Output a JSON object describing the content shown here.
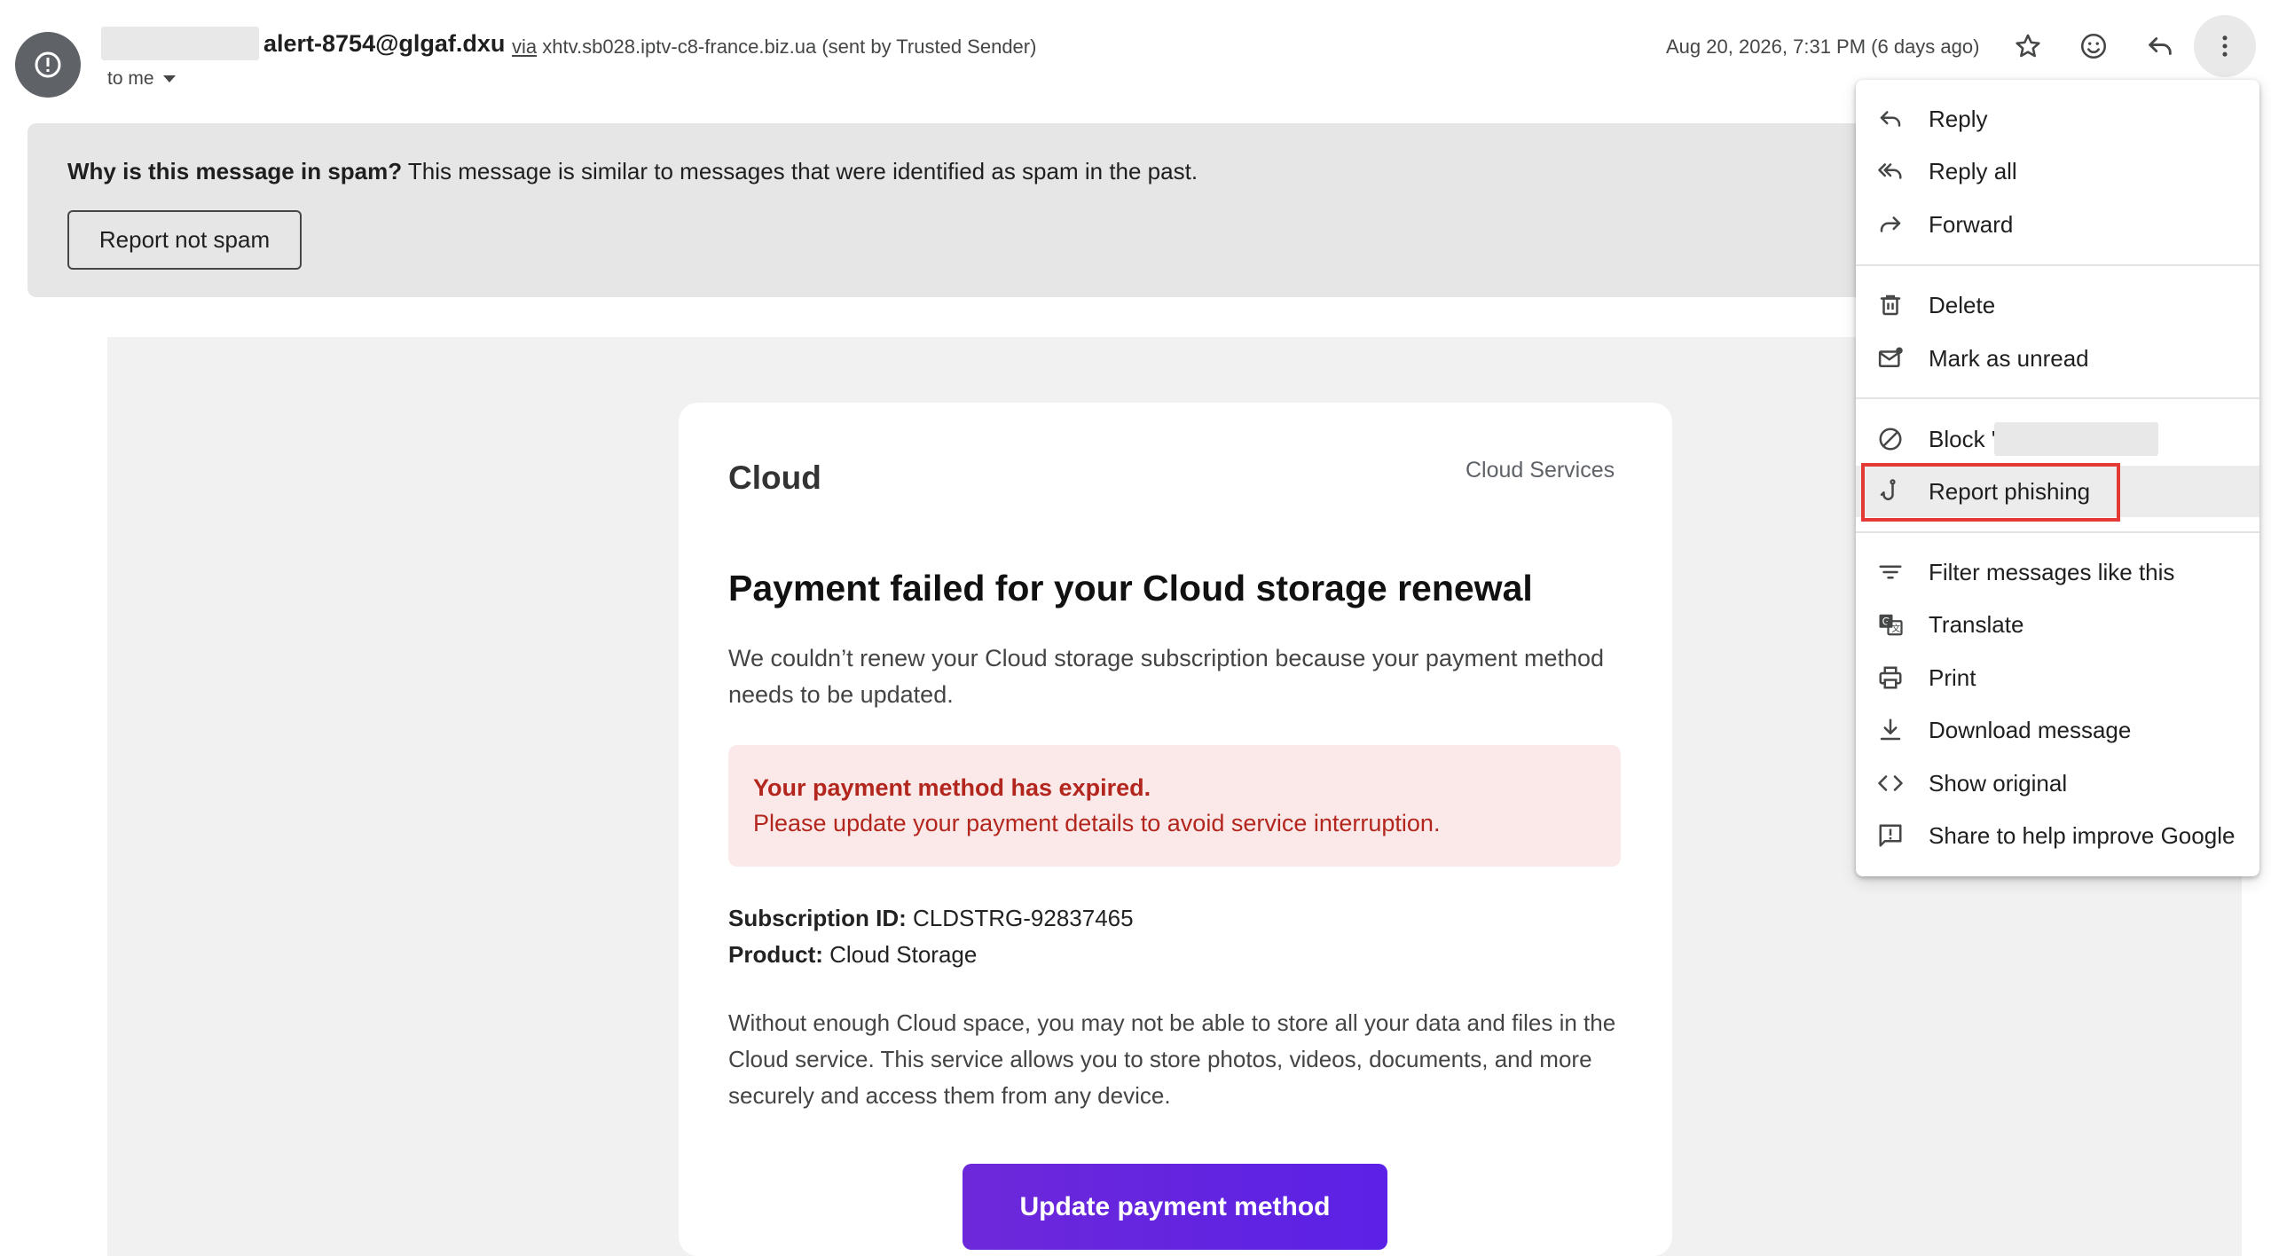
{
  "header": {
    "sender_email": "alert-8754@glgaf.dxu",
    "via_label": "via",
    "via_domain": "xhtv.sb028.iptv-c8-france.biz.ua (sent by Trusted Sender)",
    "to_label": "to me",
    "date": "Aug 20, 2026, 7:31 PM (6 days ago)",
    "icons": [
      "spam-alert-icon",
      "star-icon",
      "emoji-icon",
      "reply-icon",
      "more-vert-icon"
    ]
  },
  "spam_banner": {
    "question": "Why is this message in spam?",
    "explanation": " This message is similar to messages that were identified as spam in the past.",
    "button": "Report not spam"
  },
  "email": {
    "brand": "Cloud",
    "brand_right": "Cloud Services",
    "headline": "Payment failed for your Cloud storage renewal",
    "intro": "We couldn’t renew your Cloud storage subscription because your payment method needs to be updated.",
    "alert_title": "Your payment method has expired.",
    "alert_body": "Please update your payment details to avoid service interruption.",
    "subscription_label": "Subscription ID:",
    "subscription_value": " CLDSTRG-92837465",
    "product_label": "Product:",
    "product_value": " Cloud Storage",
    "body": "Without enough Cloud space, you may not be able to store all your data and files in the Cloud service. This service allows you to store photos, videos, documents, and more securely and access them from any device.",
    "cta": "Update payment method"
  },
  "menu": {
    "reply": "Reply",
    "reply_all": "Reply all",
    "forward": "Forward",
    "delete": "Delete",
    "mark_unread": "Mark as unread",
    "block": "Block '",
    "report_phishing": "Report phishing",
    "filter": "Filter messages like this",
    "translate": "Translate",
    "print": "Print",
    "download": "Download message",
    "show_original": "Show original",
    "share": "Share to help improve Google"
  },
  "colors": {
    "highlight_box": "#e53935",
    "alert_text": "#b3261e",
    "cta_bg": "#6d28d9"
  }
}
